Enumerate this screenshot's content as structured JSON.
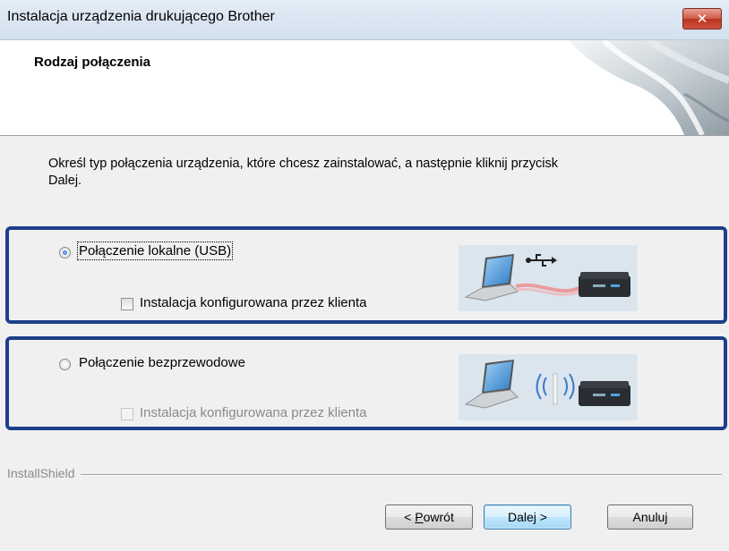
{
  "window": {
    "title": "Instalacja urządzenia drukującego Brother",
    "close_symbol": "✕"
  },
  "header": {
    "title": "Rodzaj połączenia"
  },
  "instructions": {
    "line1": "Określ typ połączenia urządzenia, które chcesz zainstalować, a następnie kliknij przycisk",
    "line2": "Dalej."
  },
  "options": [
    {
      "label": "Połączenie lokalne (USB)",
      "selected": true,
      "checkbox_label": "Instalacja konfigurowana przez klienta",
      "checkbox_checked": false,
      "checkbox_enabled": true,
      "illustration_icon": "laptop-usb-printer-icon"
    },
    {
      "label": "Połączenie bezprzewodowe",
      "selected": false,
      "checkbox_label": "Instalacja konfigurowana przez klienta",
      "checkbox_checked": false,
      "checkbox_enabled": false,
      "illustration_icon": "laptop-wireless-printer-icon"
    }
  ],
  "footer": {
    "brand": "InstallShield"
  },
  "buttons": {
    "back_accel": "P",
    "back_rest": "owrót",
    "back_prefix": "< ",
    "next": "Dalej >",
    "cancel": "Anuluj"
  },
  "colors": {
    "group_border": "#1d3f8a",
    "close_button": "#c9432f",
    "default_button": "#3c7fb1"
  }
}
